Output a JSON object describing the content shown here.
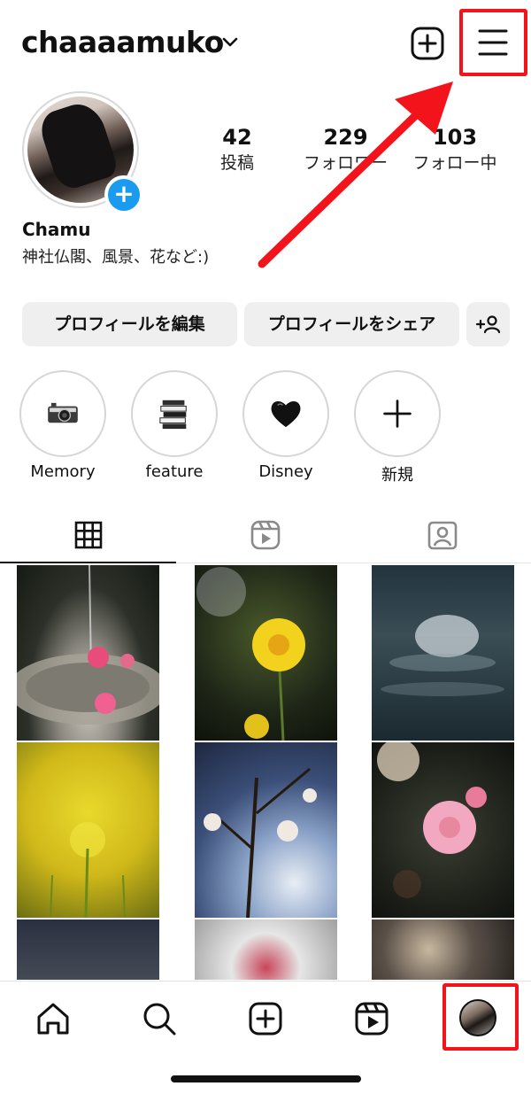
{
  "header": {
    "username": "chaaaamuko"
  },
  "profile": {
    "stats": [
      {
        "num": "42",
        "label": "投稿"
      },
      {
        "num": "229",
        "label": "フォロワー"
      },
      {
        "num": "103",
        "label": "フォロー中"
      }
    ],
    "display_name": "Chamu",
    "bio": "神社仏閣、風景、花など:)"
  },
  "actions": {
    "edit_profile": "プロフィールを編集",
    "share_profile": "プロフィールをシェア"
  },
  "highlights": [
    {
      "label": "Memory",
      "icon": "camera-icon"
    },
    {
      "label": "feature",
      "icon": "book-stack-icon"
    },
    {
      "label": "Disney",
      "icon": "heart-icon"
    },
    {
      "label": "新規",
      "icon": "plus-icon"
    }
  ],
  "tabs": [
    {
      "name": "grid",
      "icon": "grid-icon"
    },
    {
      "name": "reels",
      "icon": "reels-icon"
    },
    {
      "name": "tagged",
      "icon": "tagged-icon"
    }
  ],
  "bottom_nav": [
    {
      "name": "home",
      "icon": "home-icon"
    },
    {
      "name": "search",
      "icon": "search-icon"
    },
    {
      "name": "create",
      "icon": "add-post-icon"
    },
    {
      "name": "reels",
      "icon": "reels-icon"
    },
    {
      "name": "profile",
      "icon": "profile-avatar-icon"
    }
  ],
  "colors": {
    "highlight_red": "#f3141b",
    "accent_blue": "#1a9bf0",
    "button_bg": "#efefef"
  }
}
